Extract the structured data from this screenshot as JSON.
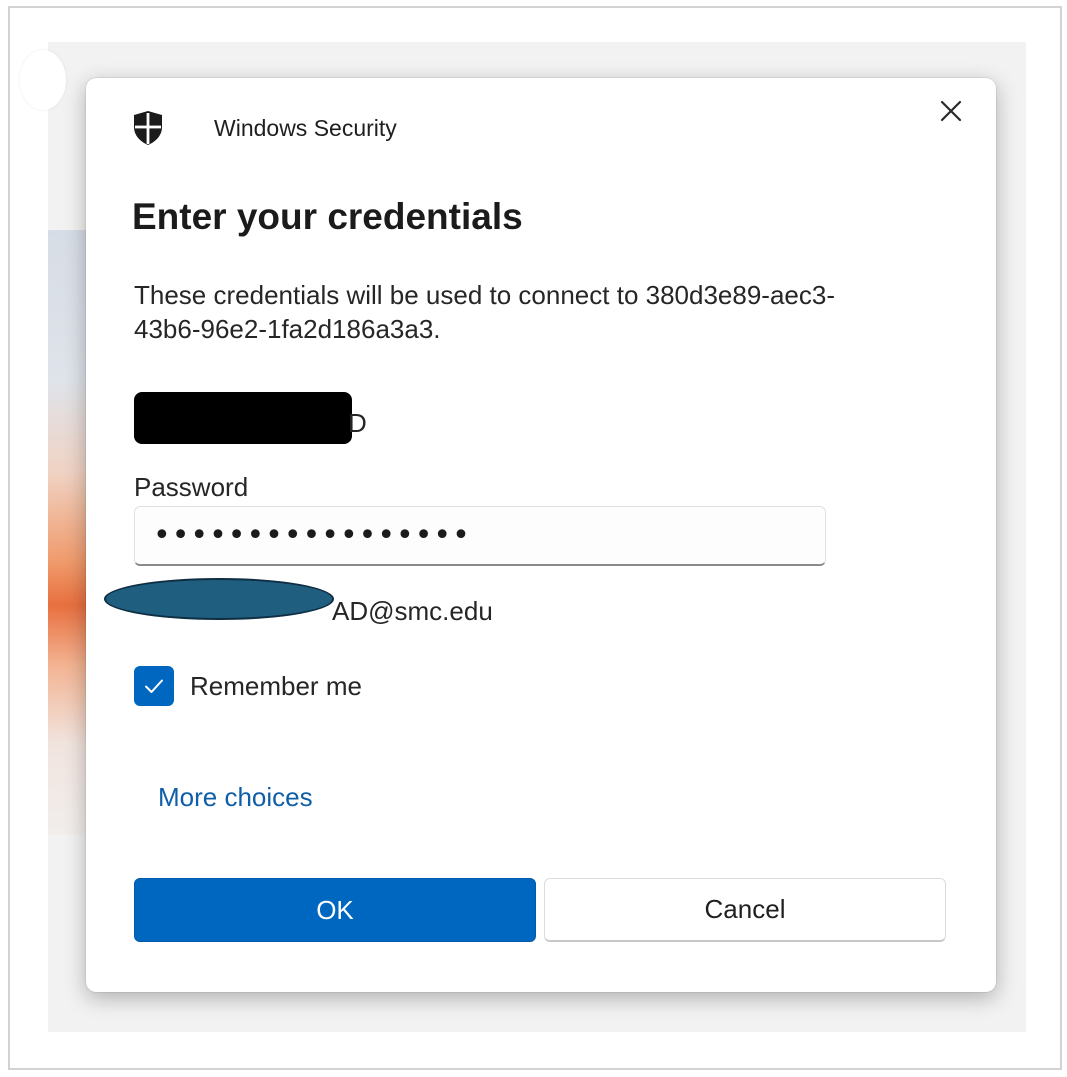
{
  "dialog": {
    "window_title": "Windows Security",
    "heading": "Enter your credentials",
    "description": "These credentials will be used to connect to 380d3e89-aec3-43b6-96e2-1fa2d186a3a3.",
    "username_visible_tail": "D",
    "password_label": "Password",
    "password_value": "•••••••••••••••••",
    "account_visible_text": "AD@smc.edu",
    "remember_me": {
      "label": "Remember me",
      "checked": true
    },
    "more_choices_label": "More choices",
    "ok_label": "OK",
    "cancel_label": "Cancel"
  },
  "icons": {
    "title_icon": "shield-icon",
    "close_icon": "close-icon",
    "checkbox_icon": "checkmark-icon"
  },
  "colors": {
    "accent": "#0067c0",
    "link": "#0f5fa8",
    "redaction": "#000000",
    "account_mask": "#1f5e7f"
  }
}
